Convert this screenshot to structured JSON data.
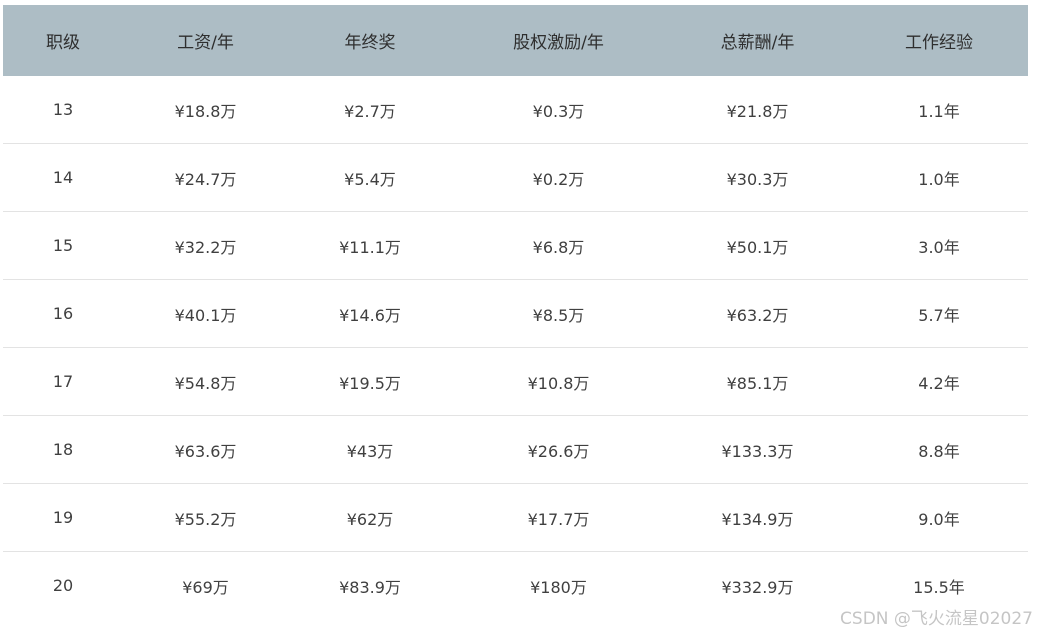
{
  "table": {
    "headers": [
      "职级",
      "工资/年",
      "年终奖",
      "股权激励/年",
      "总薪酬/年",
      "工作经验"
    ],
    "rows": [
      [
        "13",
        "¥18.8万",
        "¥2.7万",
        "¥0.3万",
        "¥21.8万",
        "1.1年"
      ],
      [
        "14",
        "¥24.7万",
        "¥5.4万",
        "¥0.2万",
        "¥30.3万",
        "1.0年"
      ],
      [
        "15",
        "¥32.2万",
        "¥11.1万",
        "¥6.8万",
        "¥50.1万",
        "3.0年"
      ],
      [
        "16",
        "¥40.1万",
        "¥14.6万",
        "¥8.5万",
        "¥63.2万",
        "5.7年"
      ],
      [
        "17",
        "¥54.8万",
        "¥19.5万",
        "¥10.8万",
        "¥85.1万",
        "4.2年"
      ],
      [
        "18",
        "¥63.6万",
        "¥43万",
        "¥26.6万",
        "¥133.3万",
        "8.8年"
      ],
      [
        "19",
        "¥55.2万",
        "¥62万",
        "¥17.7万",
        "¥134.9万",
        "9.0年"
      ],
      [
        "20",
        "¥69万",
        "¥83.9万",
        "¥180万",
        "¥332.9万",
        "15.5年"
      ]
    ]
  },
  "watermark": "CSDN @飞火流星02027",
  "colors": {
    "header_background": "#adbdc5",
    "row_divider": "#e3e3e3",
    "text": "#404040"
  }
}
